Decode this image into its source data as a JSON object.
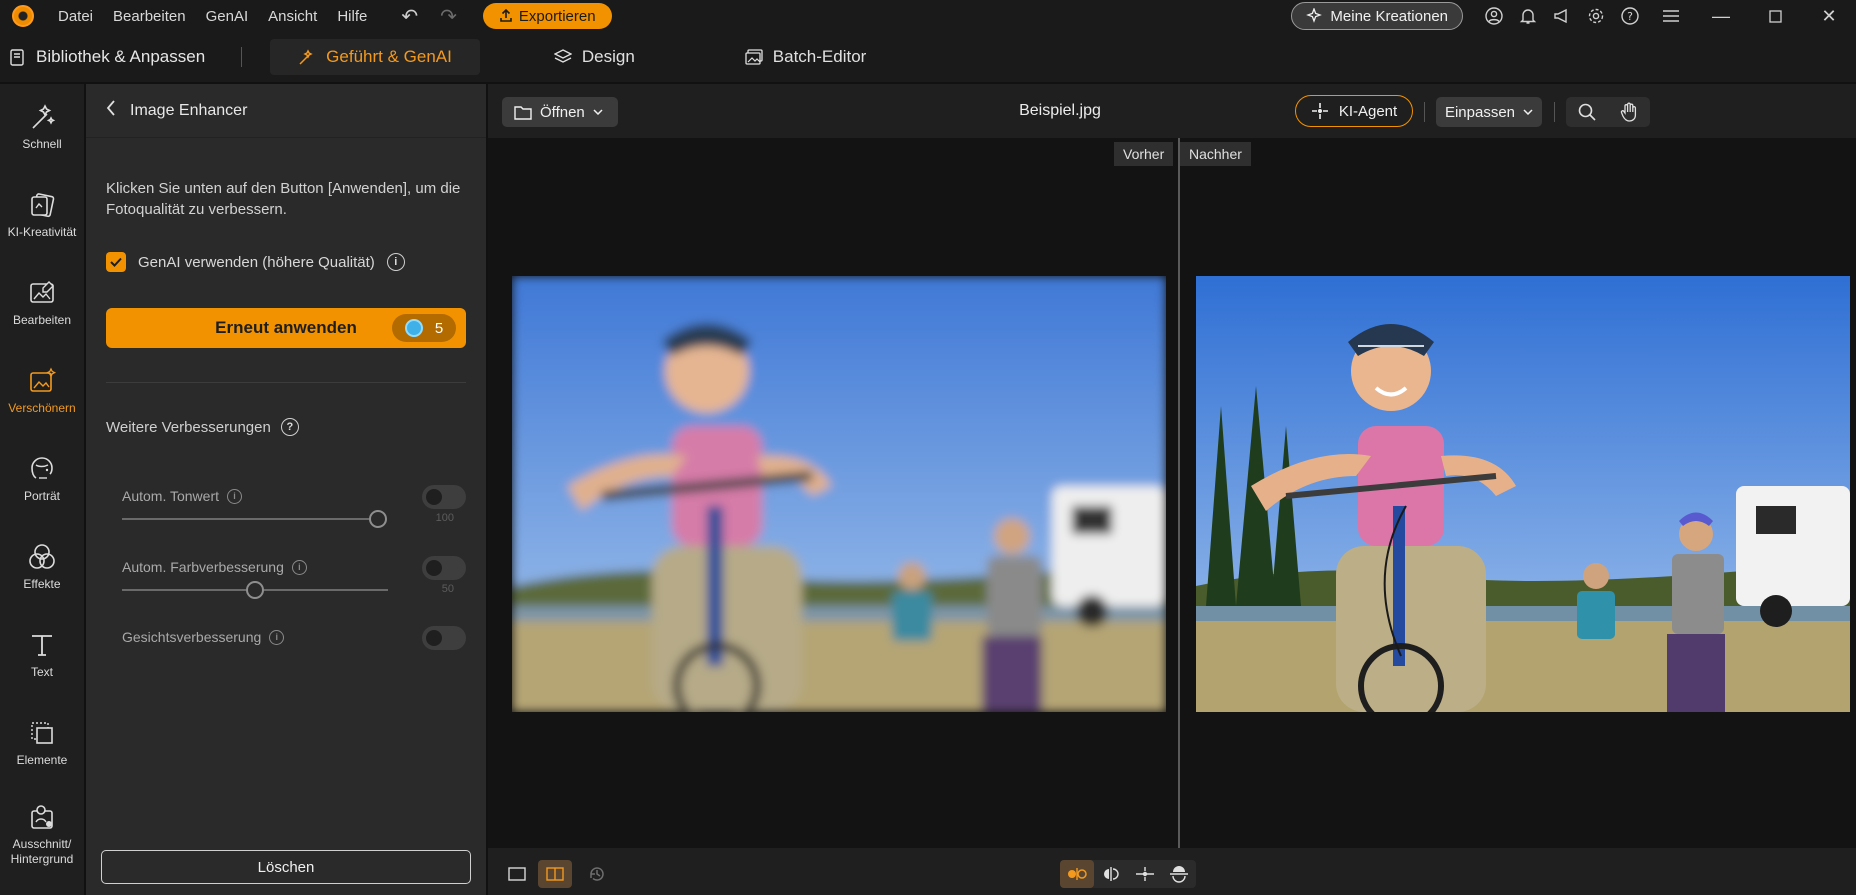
{
  "menu": [
    "Datei",
    "Bearbeiten",
    "GenAI",
    "Ansicht",
    "Hilfe"
  ],
  "export_label": "Exportieren",
  "creations_label": "Meine Kreationen",
  "modes": {
    "library": "Bibliothek & Anpassen",
    "guided": "Geführt & GenAI",
    "design": "Design",
    "batch": "Batch-Editor"
  },
  "rail": [
    {
      "label": "Schnell",
      "icon": "magic-wand-icon"
    },
    {
      "label": "KI-Kreativität",
      "icon": "ai-creativity-icon"
    },
    {
      "label": "Bearbeiten",
      "icon": "edit-image-icon"
    },
    {
      "label": "Verschönern",
      "icon": "beautify-icon"
    },
    {
      "label": "Porträt",
      "icon": "portrait-icon"
    },
    {
      "label": "Effekte",
      "icon": "effects-icon"
    },
    {
      "label": "Text",
      "icon": "text-icon"
    },
    {
      "label": "Elemente",
      "icon": "elements-icon"
    },
    {
      "label": "Ausschnitt/\nHintergrund",
      "icon": "cutout-icon"
    }
  ],
  "panel": {
    "title": "Image Enhancer",
    "description": "Klicken Sie unten auf den Button [Anwenden], um die Fotoqualität zu verbessern.",
    "genai_label": "GenAI verwenden (höhere Qualität)",
    "genai_checked": true,
    "apply_label": "Erneut anwenden",
    "credits": "5",
    "more_label": "Weitere Verbesserungen",
    "options": [
      {
        "label": "Autom. Tonwert",
        "enabled": false,
        "slider_value": "100",
        "slider_fraction": 1.0
      },
      {
        "label": "Autom. Farbverbesserung",
        "enabled": false,
        "slider_value": "50",
        "slider_fraction": 0.5
      },
      {
        "label": "Gesichtsverbesserung",
        "enabled": false
      }
    ],
    "delete_label": "Löschen"
  },
  "canvas": {
    "open_label": "Öffnen",
    "file_name": "Beispiel.jpg",
    "agent_label": "KI-Agent",
    "fit_label": "Einpassen",
    "before_label": "Vorher",
    "after_label": "Nachher"
  },
  "colors": {
    "accent": "#f39200",
    "background": "#131313",
    "panel": "#2a2a2a"
  }
}
